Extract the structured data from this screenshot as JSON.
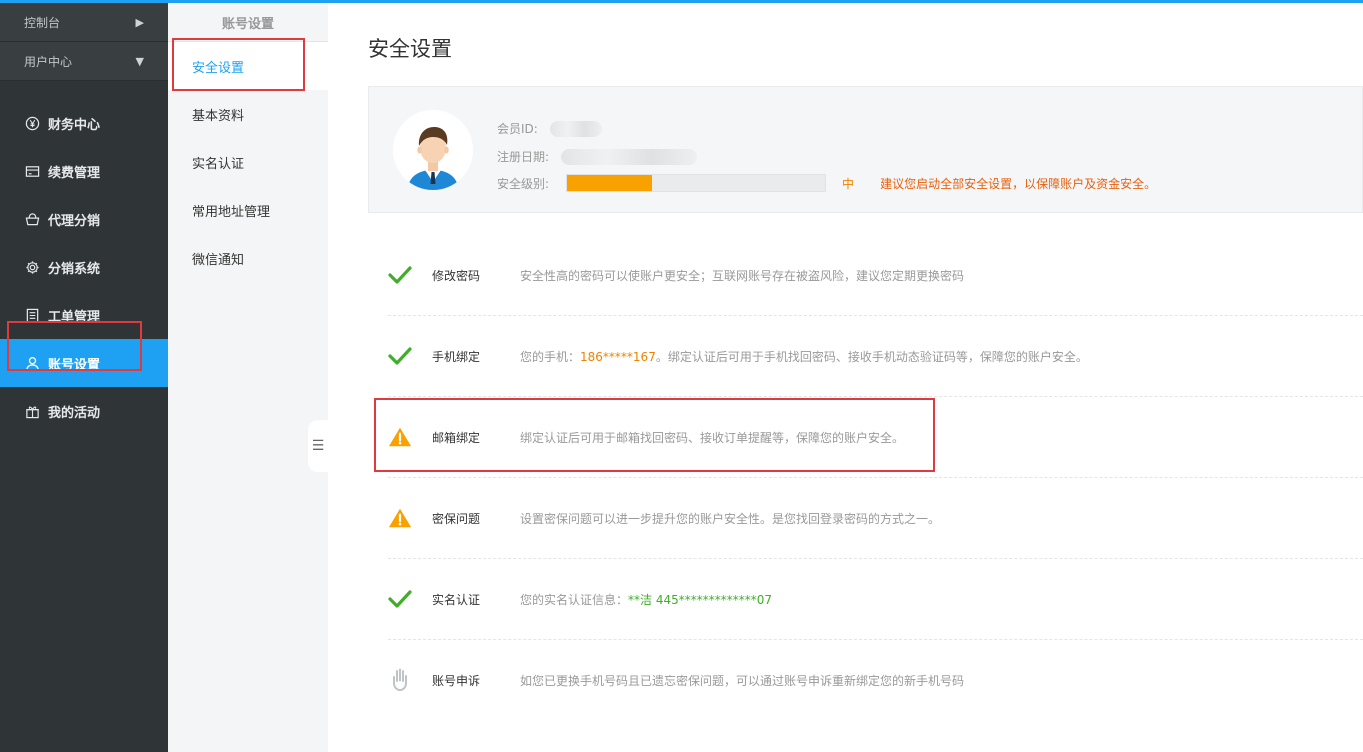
{
  "sidebar": {
    "head1": "控制台",
    "head2": "用户中心",
    "items": [
      {
        "label": "财务中心",
        "icon": "yen-circle-icon"
      },
      {
        "label": "续费管理",
        "icon": "card-icon"
      },
      {
        "label": "代理分销",
        "icon": "basket-icon"
      },
      {
        "label": "分销系统",
        "icon": "gear-icon"
      },
      {
        "label": "工单管理",
        "icon": "document-icon"
      },
      {
        "label": "账号设置",
        "icon": "user-icon"
      },
      {
        "label": "我的活动",
        "icon": "gift-icon"
      }
    ]
  },
  "subnav": {
    "title": "账号设置",
    "items": [
      {
        "label": "安全设置"
      },
      {
        "label": "基本资料"
      },
      {
        "label": "实名认证"
      },
      {
        "label": "常用地址管理"
      },
      {
        "label": "微信通知"
      }
    ]
  },
  "main": {
    "title": "安全设置",
    "profile": {
      "member_id_label": "会员ID:",
      "reg_date_label": "注册日期:",
      "level_label": "安全级别:",
      "level_value": "中",
      "level_fraction": 0.33,
      "level_tip": "建议您启动全部安全设置，以保障账户及资金安全。"
    },
    "security_items": [
      {
        "name": "修改密码",
        "status": "ok",
        "desc": "安全性高的密码可以使账户更安全；互联网账号存在被盗风险，建议您定期更换密码"
      },
      {
        "name": "手机绑定",
        "status": "ok",
        "desc_prefix": "您的手机：",
        "highlight": "186*****167",
        "desc_suffix": "。绑定认证后可用于手机找回密码、接收手机动态验证码等，保障您的账户安全。"
      },
      {
        "name": "邮箱绑定",
        "status": "warn",
        "desc": "绑定认证后可用于邮箱找回密码、接收订单提醒等，保障您的账户安全。"
      },
      {
        "name": "密保问题",
        "status": "warn",
        "desc": "设置密保问题可以进一步提升您的账户安全性。是您找回登录密码的方式之一。"
      },
      {
        "name": "实名认证",
        "status": "ok",
        "desc_prefix": "您的实名认证信息：",
        "highlight": "**洁 445*************07"
      },
      {
        "name": "账号申诉",
        "status": "hand",
        "desc": "如您已更换手机号码且已遗忘密保问题，可以通过账号申诉重新绑定您的新手机号码"
      }
    ]
  },
  "colors": {
    "accent": "#1ea1f2",
    "sidebar_bg": "#2f3437",
    "warn": "#f8a100",
    "ok": "#3fae29",
    "highlight_box": "#e0393e"
  }
}
